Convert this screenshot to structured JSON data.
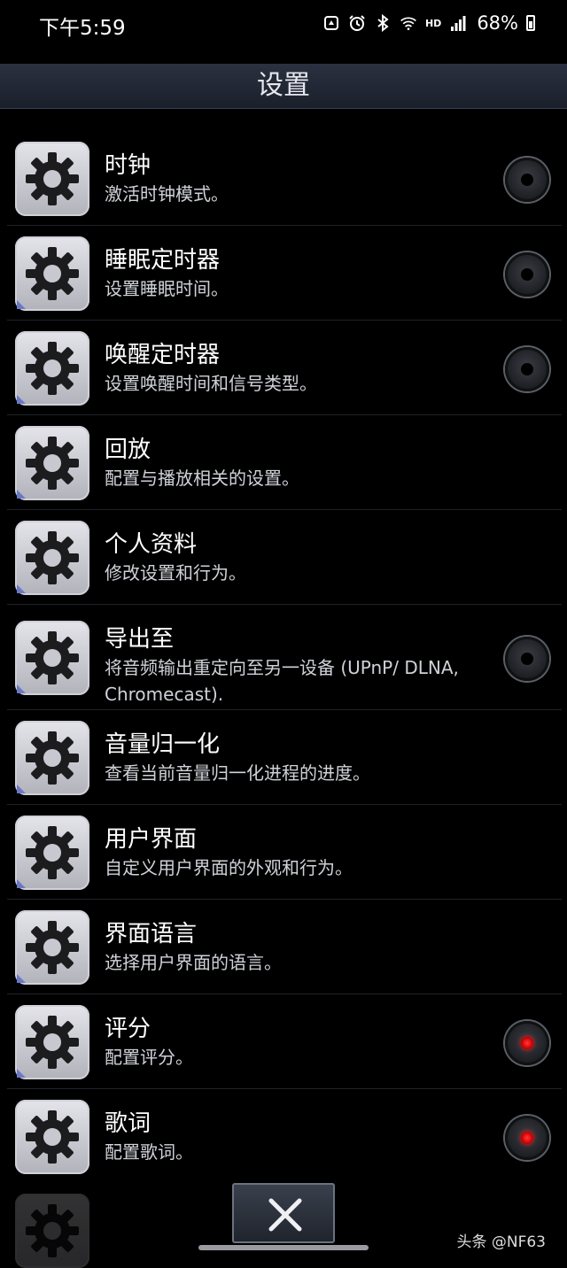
{
  "status_bar": {
    "time": "下午5:59",
    "network": "HD",
    "battery": "68%",
    "icons": [
      "recycle-icon",
      "alarm-icon",
      "bluetooth-icon",
      "wifi-icon",
      "signal-icon",
      "battery-icon"
    ]
  },
  "header": {
    "title": "设置"
  },
  "items": [
    {
      "title": "时钟",
      "subtitle": "激活时钟模式。",
      "toggle": "off"
    },
    {
      "title": "睡眠定时器",
      "subtitle": "设置睡眠时间。",
      "toggle": "off"
    },
    {
      "title": "唤醒定时器",
      "subtitle": "设置唤醒时间和信号类型。",
      "toggle": "off"
    },
    {
      "title": "回放",
      "subtitle": "配置与播放相关的设置。",
      "toggle": "none"
    },
    {
      "title": "个人资料",
      "subtitle": "修改设置和行为。",
      "toggle": "none"
    },
    {
      "title": "导出至",
      "subtitle": "将音频输出重定向至另一设备 (UPnP/ DLNA, Chromecast).",
      "toggle": "off"
    },
    {
      "title": "音量归一化",
      "subtitle": "查看当前音量归一化进程的进度。",
      "toggle": "none"
    },
    {
      "title": "用户界面",
      "subtitle": "自定义用户界面的外观和行为。",
      "toggle": "none"
    },
    {
      "title": "界面语言",
      "subtitle": "选择用户界面的语言。",
      "toggle": "none"
    },
    {
      "title": "评分",
      "subtitle": "配置评分。",
      "toggle": "on"
    },
    {
      "title": "歌词",
      "subtitle": "配置歌词。",
      "toggle": "on"
    }
  ],
  "watermark": "头条 @NF63",
  "colors": {
    "toggle_on": "#e00000",
    "header_bg": "#252a36",
    "accent_corner": "#6a79c6"
  }
}
